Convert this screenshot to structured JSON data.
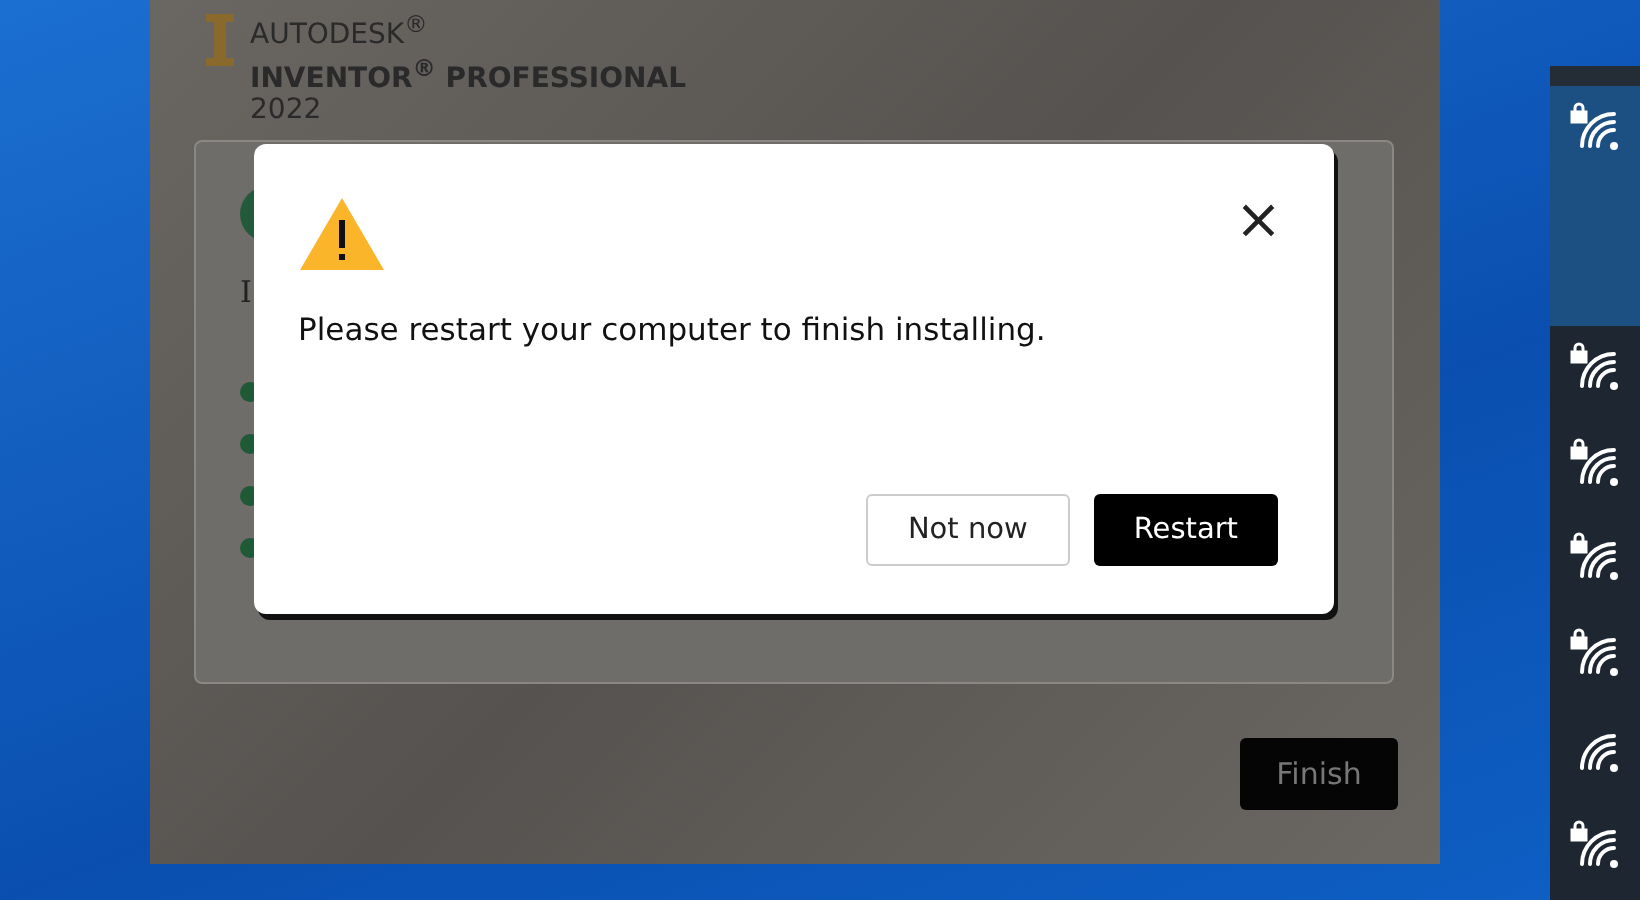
{
  "installer": {
    "brand": "AUTODESK$^{®}$",
    "product": "INVENTOR$^{®}$ PROFESSIONAL",
    "year": "2022",
    "card": {
      "partial_text": "I",
      "steps": [
        {
          "done": true
        },
        {
          "done": true
        },
        {
          "done": true
        },
        {
          "done": true
        }
      ]
    },
    "finish_button": "Finish"
  },
  "dialog": {
    "message": "Please restart your computer to finish installing.",
    "close": "×",
    "buttons": [
      {
        "label": "Not now",
        "kind": "secondary"
      },
      {
        "label": "Restart",
        "kind": "primary"
      }
    ]
  },
  "networks": [
    {
      "locked": true,
      "selected": true
    },
    {
      "locked": true,
      "selected": false
    },
    {
      "locked": true,
      "selected": false
    },
    {
      "locked": true,
      "selected": false
    },
    {
      "locked": true,
      "selected": false
    },
    {
      "locked": false,
      "selected": false
    },
    {
      "locked": true,
      "selected": false
    }
  ]
}
